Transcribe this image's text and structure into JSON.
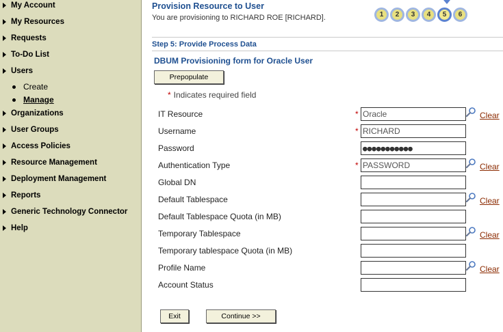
{
  "sidebar": {
    "items": [
      {
        "label": "My Account"
      },
      {
        "label": "My Resources"
      },
      {
        "label": "Requests"
      },
      {
        "label": "To-Do List"
      },
      {
        "label": "Users"
      },
      {
        "label": "Organizations"
      },
      {
        "label": "User Groups"
      },
      {
        "label": "Access Policies"
      },
      {
        "label": "Resource Management"
      },
      {
        "label": "Deployment Management"
      },
      {
        "label": "Reports"
      },
      {
        "label": "Generic Technology Connector"
      },
      {
        "label": "Help"
      }
    ],
    "users_sub": [
      {
        "label": "Create"
      },
      {
        "label": "Manage"
      }
    ]
  },
  "header": {
    "title": "Provision Resource to User",
    "subtitle": "You are provisioning to RICHARD ROE [RICHARD]."
  },
  "steps": [
    "1",
    "2",
    "3",
    "4",
    "5",
    "6"
  ],
  "current_step": "5",
  "step_heading": "Step 5:  Provide Process Data",
  "form": {
    "heading": "DBUM Provisioning form for Oracle User",
    "prepopulate_label": "Prepopulate",
    "required_star": "*",
    "required_note": "Indicates required field",
    "clear_label": "Clear",
    "fields": [
      {
        "label": "IT Resource",
        "value": "Oracle",
        "required": true,
        "lookup": true
      },
      {
        "label": "Username",
        "value": "RICHARD",
        "required": true,
        "lookup": false
      },
      {
        "label": "Password",
        "value": "●●●●●●●●●●●",
        "required": false,
        "lookup": false
      },
      {
        "label": "Authentication Type",
        "value": "PASSWORD",
        "required": true,
        "lookup": true
      },
      {
        "label": "Global DN",
        "value": "",
        "required": false,
        "lookup": false
      },
      {
        "label": "Default Tablespace",
        "value": "",
        "required": false,
        "lookup": true
      },
      {
        "label": "Default Tablespace Quota (in MB)",
        "value": "",
        "required": false,
        "lookup": false
      },
      {
        "label": "Temporary Tablespace",
        "value": "",
        "required": false,
        "lookup": true
      },
      {
        "label": "Temporary tablespace Quota (in MB)",
        "value": "",
        "required": false,
        "lookup": false
      },
      {
        "label": "Profile Name",
        "value": "",
        "required": false,
        "lookup": true
      },
      {
        "label": "Account Status",
        "value": "",
        "required": false,
        "lookup": false
      }
    ],
    "exit_label": "Exit",
    "continue_label": "Continue >>"
  },
  "colors": {
    "sidebar_bg": "#dcdcbc",
    "heading_blue": "#1e4f90",
    "required_red": "#c00000",
    "clear_link": "#8b2a00"
  }
}
